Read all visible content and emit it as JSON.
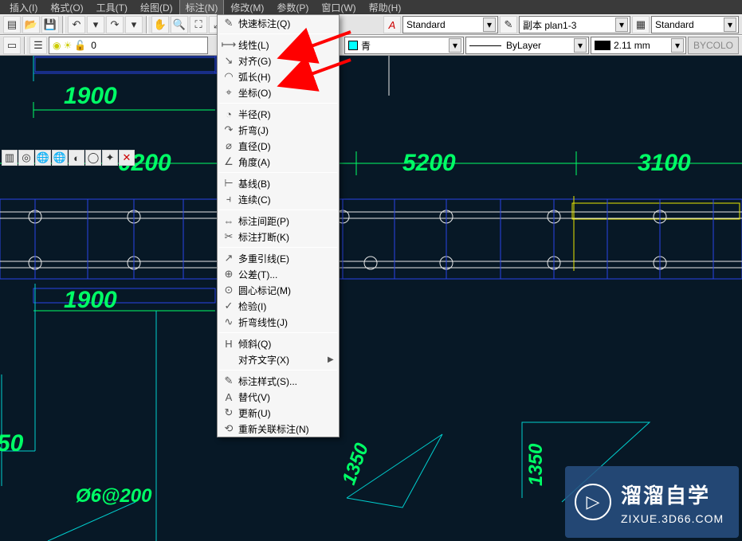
{
  "menubar": {
    "items": [
      {
        "label": "插入(I)"
      },
      {
        "label": "格式(O)"
      },
      {
        "label": "工具(T)"
      },
      {
        "label": "绘图(D)"
      },
      {
        "label": "标注(N)",
        "active": true
      },
      {
        "label": "修改(M)"
      },
      {
        "label": "参数(P)"
      },
      {
        "label": "窗口(W)"
      },
      {
        "label": "帮助(H)"
      }
    ]
  },
  "toolbar1": {
    "textstyle": {
      "value": "Standard"
    },
    "dimstyle": {
      "value": "副本 plan1-3"
    },
    "tablestyle": {
      "value": "Standard"
    }
  },
  "toolbar2": {
    "layer_lock_value": "0",
    "color": {
      "value": "青",
      "swatch": "#00ffff"
    },
    "linetype": {
      "value": "ByLayer"
    },
    "lineweight": {
      "value": "2.11 mm",
      "swatch": "#000000"
    },
    "bycolor_label": "BYCOLO"
  },
  "dropdown": {
    "groups": [
      [
        {
          "icon": "✎",
          "label": "快速标注(Q)"
        }
      ],
      [
        {
          "icon": "⟼",
          "label": "线性(L)"
        },
        {
          "icon": "↘",
          "label": "对齐(G)"
        },
        {
          "icon": "◠",
          "label": "弧长(H)"
        },
        {
          "icon": "⌖",
          "label": "坐标(O)"
        }
      ],
      [
        {
          "icon": "◔",
          "label": "半径(R)"
        },
        {
          "icon": "↷",
          "label": "折弯(J)"
        },
        {
          "icon": "⌀",
          "label": "直径(D)"
        },
        {
          "icon": "∠",
          "label": "角度(A)"
        }
      ],
      [
        {
          "icon": "⊢",
          "label": "基线(B)"
        },
        {
          "icon": "⫞",
          "label": "连续(C)"
        }
      ],
      [
        {
          "icon": "⇔",
          "label": "标注间距(P)"
        },
        {
          "icon": "✂",
          "label": "标注打断(K)"
        }
      ],
      [
        {
          "icon": "↗",
          "label": "多重引线(E)"
        },
        {
          "icon": "⊕",
          "label": "公差(T)..."
        },
        {
          "icon": "⊙",
          "label": "圆心标记(M)"
        },
        {
          "icon": "✓",
          "label": "检验(I)"
        },
        {
          "icon": "∿",
          "label": "折弯线性(J)"
        }
      ],
      [
        {
          "icon": "H",
          "label": "倾斜(Q)"
        },
        {
          "icon": "",
          "label": "对齐文字(X)",
          "arrow": true
        }
      ],
      [
        {
          "icon": "✎",
          "label": "标注样式(S)..."
        },
        {
          "icon": "A",
          "label": "替代(V)"
        },
        {
          "icon": "↻",
          "label": "更新(U)"
        },
        {
          "icon": "⟲",
          "label": "重新关联标注(N)"
        }
      ]
    ]
  },
  "dimensions": {
    "d1900a": "1900",
    "d0200": "0200",
    "d5200": "5200",
    "d3100": "3100",
    "d1900b": "1900",
    "d50": "50",
    "d1350a": "1350",
    "d1350b": "1350",
    "phi": "Ø6@200"
  },
  "watermark": {
    "brand": "溜溜自学",
    "url": "ZIXUE.3D66.COM"
  }
}
